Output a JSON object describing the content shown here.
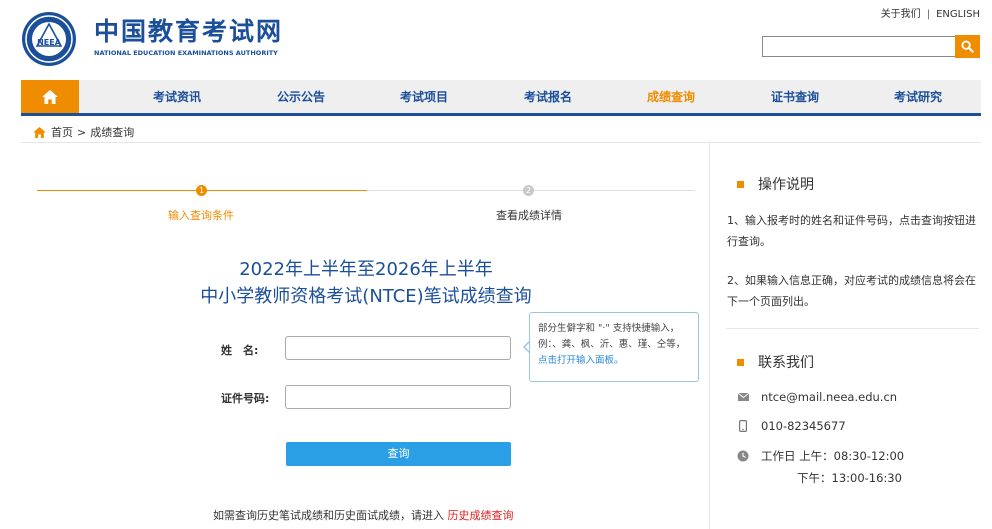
{
  "header": {
    "brand_cn": "中国教育考试网",
    "brand_en": "NATIONAL EDUCATION EXAMINATIONS AUTHORITY",
    "logo_text": "NEEA",
    "top_links": {
      "about": "关于我们",
      "separator": "|",
      "english": "ENGLISH"
    },
    "search": {
      "value": "",
      "placeholder": ""
    }
  },
  "nav": {
    "items": [
      {
        "label": "考试资讯"
      },
      {
        "label": "公示公告"
      },
      {
        "label": "考试项目"
      },
      {
        "label": "考试报名"
      },
      {
        "label": "成绩查询"
      },
      {
        "label": "证书查询"
      },
      {
        "label": "考试研究"
      }
    ],
    "active_index": 4
  },
  "breadcrumb": {
    "home": "首页",
    "separator": ">",
    "current": "成绩查询"
  },
  "steps": [
    {
      "num": "1",
      "label": "输入查询条件"
    },
    {
      "num": "2",
      "label": "查看成绩详情"
    }
  ],
  "title": {
    "line1": "2022年上半年至2026年上半年",
    "line2": "中小学教师资格考试(NTCE)笔试成绩查询"
  },
  "form": {
    "name_label": "姓　名:",
    "name_value": "",
    "id_label": "证件号码:",
    "id_value": "",
    "tooltip_text": "部分生僻字和 \"·\" 支持快捷输入，例：、龚、枫、沂、惠、瑾、仝等，",
    "tooltip_link": "点击打开输入面板。",
    "query_button": "查询",
    "history_text": "如需查询历史笔试成绩和历史面试成绩，请进入",
    "history_link": "历史成绩查询"
  },
  "instructions": {
    "title": "操作说明",
    "items": [
      "1、输入报考时的姓名和证件号码，点击查询按钮进行查询。",
      "2、如果输入信息正确，对应考试的成绩信息将会在下一个页面列出。"
    ]
  },
  "contact": {
    "title": "联系我们",
    "email": "ntce@mail.neea.edu.cn",
    "phone": "010-82345677",
    "hours_am": "工作日 上午：08:30-12:00",
    "hours_pm": "下午：13:00-16:30"
  },
  "colors": {
    "brand_blue": "#1b4f9a",
    "accent_orange": "#f08c00",
    "button_blue": "#2a9fe6",
    "link_red": "#e02020"
  }
}
